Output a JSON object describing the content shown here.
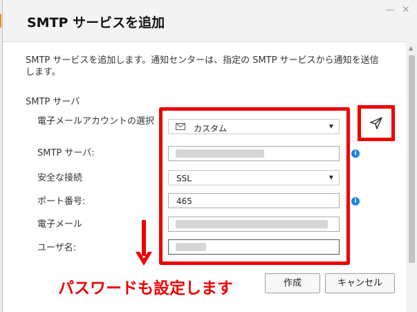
{
  "dialog": {
    "title": "SMTP サービスを追加",
    "minimize_glyph": "—",
    "close_glyph": "✕",
    "intro": "SMTP サービスを追加します。通知センターは、指定の SMTP サービスから通知を送信します。",
    "section_label": "SMTP サーバ"
  },
  "form": {
    "account": {
      "label": "電子メールアカウントの選択",
      "value": "カスタム",
      "icon": "mail-icon"
    },
    "smtp_server": {
      "label": "SMTP サーバ:",
      "value": ""
    },
    "secure_connection": {
      "label": "安全な接続",
      "value": "SSL"
    },
    "port": {
      "label": "ポート番号:",
      "value": "465"
    },
    "email": {
      "label": "電子メール",
      "value": ""
    },
    "username": {
      "label": "ユーザ名:",
      "value": ""
    }
  },
  "info_glyph": "i",
  "icons": {
    "send": "send-icon",
    "info": "info-icon",
    "dropdown": "chevron-down-icon"
  },
  "annotation": {
    "text": "パスワードも設定します",
    "color": "#ee0000"
  },
  "buttons": {
    "create": "作成",
    "cancel": "キャンセル"
  },
  "colors": {
    "highlight": "#ee0000",
    "info": "#1a82e2",
    "accent": "#f28a1c"
  }
}
